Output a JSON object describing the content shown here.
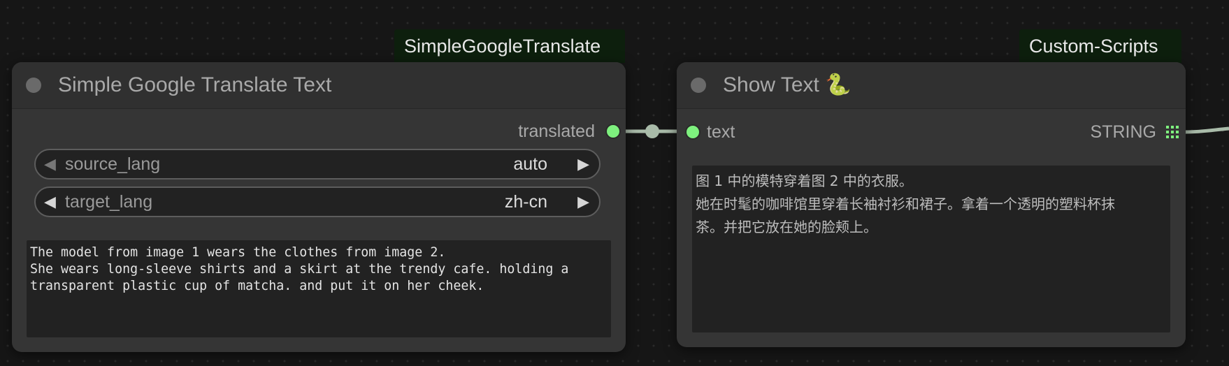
{
  "theme": {
    "canvas_bg": "#161616",
    "node_bg": "#353535",
    "badge_bg": "#0d1f0d",
    "slot_color": "#7ef07e",
    "link_color": "#a9bba9"
  },
  "nodes": [
    {
      "source_badge": "SimpleGoogleTranslate",
      "title": "Simple Google Translate Text",
      "output_slot": "translated",
      "widgets": [
        {
          "name": "source_lang",
          "value": "auto"
        },
        {
          "name": "target_lang",
          "value": "zh-cn"
        }
      ],
      "text": "The model from image 1 wears the clothes from image 2.\nShe wears long-sleeve shirts and a skirt at the trendy cafe. holding a\ntransparent plastic cup of matcha. and put it on her cheek."
    },
    {
      "source_badge": "Custom-Scripts",
      "title": "Show Text 🐍",
      "input_slot": "text",
      "output_slot": "STRING",
      "text": "图 1 中的模特穿着图 2 中的衣服。\n她在时髦的咖啡馆里穿着长袖衬衫和裙子。拿着一个透明的塑料杯抹\n茶。并把它放在她的脸颊上。"
    }
  ]
}
